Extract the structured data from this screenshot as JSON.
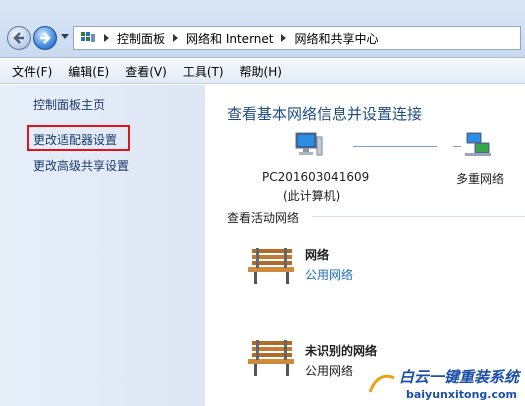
{
  "breadcrumb": {
    "items": [
      "控制面板",
      "网络和 Internet",
      "网络和共享中心"
    ]
  },
  "menu": {
    "items": [
      "文件(F)",
      "编辑(E)",
      "查看(V)",
      "工具(T)",
      "帮助(H)"
    ]
  },
  "sidebar": {
    "home": "控制面板主页",
    "adapter_settings": "更改适配器设置",
    "advanced_sharing": "更改高级共享设置"
  },
  "main": {
    "title": "查看基本网络信息并设置连接",
    "computer_name": "PC201603041609",
    "computer_sub": "(此计算机)",
    "network_name": "多重网络",
    "active_section": "查看活动网络",
    "networks": [
      {
        "name": "网络",
        "type": "公用网络"
      },
      {
        "name": "未识别的网络",
        "type": "公用网络"
      }
    ]
  },
  "watermark": {
    "title": "白云一键重装系统",
    "url": "baiyunxitong.com"
  },
  "colors": {
    "highlight": "#e0141a",
    "link": "#1d6fb8",
    "title": "#1f4d86"
  }
}
